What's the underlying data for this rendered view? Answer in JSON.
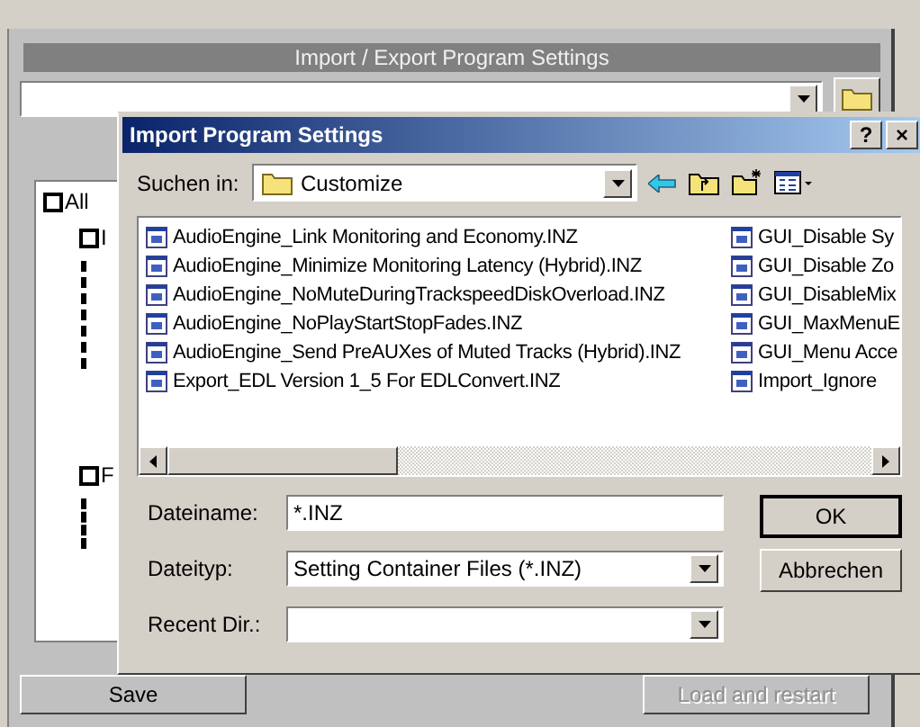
{
  "main": {
    "title": "Import / Export Program Settings",
    "tree": [
      {
        "label": "All",
        "checked": false,
        "children": [
          {
            "label": "I",
            "checked": false
          },
          {
            "label": "F",
            "checked": false
          }
        ]
      }
    ],
    "buttons": [
      {
        "label": "Save",
        "disabled": false
      },
      {
        "label": "Load and restart",
        "disabled": true
      }
    ]
  },
  "dialog": {
    "title": "Import Program Settings",
    "title_buttons": [
      "?",
      "×"
    ],
    "look_in": {
      "label": "Suchen in:",
      "value": "Customize"
    },
    "files": [
      "AudioEngine_Link Monitoring and Economy.INZ",
      "AudioEngine_Minimize Monitoring Latency (Hybrid).INZ",
      "AudioEngine_NoMuteDuringTrackspeedDiskOverload.INZ",
      "AudioEngine_NoPlayStartStopFades.INZ",
      "AudioEngine_Send PreAUXes of Muted Tracks (Hybrid).INZ",
      "Export_EDL Version 1_5 For EDLConvert.INZ",
      "GUI_Disable Sy",
      "GUI_Disable Zo",
      "GUI_DisableMix",
      "GUI_MaxMenuE",
      "GUI_Menu Acce",
      "Import_Ignore"
    ],
    "fields": [
      {
        "kind": "text",
        "label": "Dateiname:",
        "value": "*.INZ"
      },
      {
        "kind": "combo",
        "label": "Dateityp:",
        "value": "Setting Container Files (*.INZ)"
      },
      {
        "kind": "combo",
        "label": "Recent Dir.:"
      }
    ],
    "buttons": [
      {
        "label": "OK",
        "default": true
      },
      {
        "label": "Abbrechen",
        "default": false
      }
    ]
  }
}
